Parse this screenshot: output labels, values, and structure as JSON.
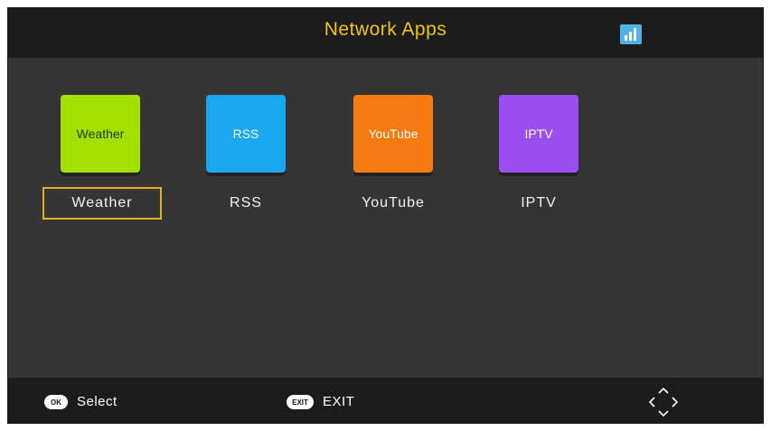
{
  "header": {
    "title": "Network Apps",
    "title_color": "#f0c419",
    "status_icon": "signal-icon"
  },
  "apps": [
    {
      "tile_label": "Weather",
      "label": "Weather",
      "color": "#a3e000",
      "tile_text_color": "#1f3a00",
      "selected": true
    },
    {
      "tile_label": "RSS",
      "label": "RSS",
      "color": "#1aa7f0",
      "tile_text_color": "#ffffff",
      "selected": false
    },
    {
      "tile_label": "YouTube",
      "label": "YouTube",
      "color": "#f57a12",
      "tile_text_color": "#ffffff",
      "selected": false
    },
    {
      "tile_label": "IPTV",
      "label": "IPTV",
      "color": "#9b4ff0",
      "tile_text_color": "#ffffff",
      "selected": false
    }
  ],
  "footer": {
    "ok_key": "OK",
    "ok_label": "Select",
    "exit_key": "EXIT",
    "exit_label": "EXIT",
    "nav_icon": "navigation-arrows-icon"
  },
  "colors": {
    "selection": "#e6b11c",
    "bar_bg": "#1c1c1c",
    "panel_bg": "#353535"
  }
}
